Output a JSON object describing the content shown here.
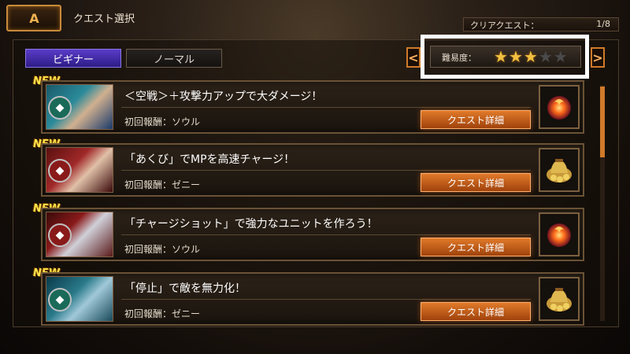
{
  "header": {
    "back_label": "A",
    "title": "クエスト選択",
    "clear_label": "クリアクエスト：",
    "clear_value": "1/8"
  },
  "tabs": [
    {
      "label": "ビギナー",
      "active": true
    },
    {
      "label": "ノーマル",
      "active": false
    }
  ],
  "difficulty": {
    "label": "難易度：",
    "stars_filled": 3,
    "stars_total": 5,
    "prev_arrow": "<",
    "next_arrow": ">"
  },
  "quests": [
    {
      "new": "NEW",
      "title": "＜空戦＞＋攻撃力アップで大ダメージ！",
      "reward": "初回報酬：ソウル",
      "button": "クエスト詳細",
      "reward_icon": "soul-orb-icon",
      "emblem": "green"
    },
    {
      "new": "NEW",
      "title": "「あくび」でMPを高速チャージ！",
      "reward": "初回報酬：ゼニー",
      "button": "クエスト詳細",
      "reward_icon": "zenny-bag-icon",
      "emblem": "red"
    },
    {
      "new": "NEW",
      "title": "「チャージショット」で強力なユニットを作ろう！",
      "reward": "初回報酬：ソウル",
      "button": "クエスト詳細",
      "reward_icon": "soul-orb-icon",
      "emblem": "red"
    },
    {
      "new": "NEW",
      "title": "「停止」で敵を無力化！",
      "reward": "初回報酬：ゼニー",
      "button": "クエスト詳細",
      "reward_icon": "zenny-bag-icon",
      "emblem": "green"
    }
  ],
  "colors": {
    "accent_orange": "#e07a2a",
    "tab_active": "#5a3cc8",
    "star_on": "#f2c040",
    "new_badge": "#ffe24a"
  }
}
